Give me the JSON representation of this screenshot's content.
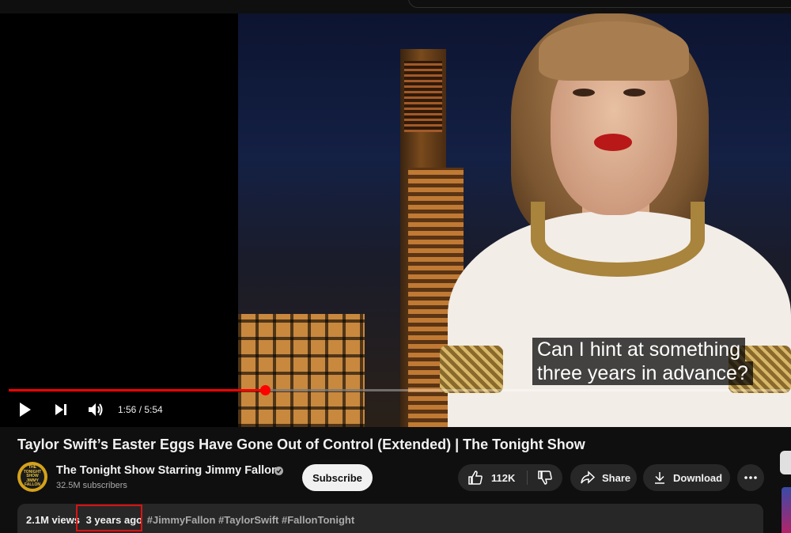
{
  "player": {
    "captions": [
      "Can I hint at something",
      "three years in advance?"
    ],
    "time_current": "1:56",
    "time_total": "5:54",
    "time_separator": " / ",
    "progress_fraction": 0.3276,
    "accent_color": "#ff0000"
  },
  "video": {
    "title": "Taylor Swift’s Easter Eggs Have Gone Out of Control (Extended) | The Tonight Show"
  },
  "channel": {
    "name": "The Tonight Show Starring Jimmy Fallon",
    "subscribers": "32.5M subscribers",
    "avatar_text": "THE TONIGHT SHOW JIMMY FALLON",
    "subscribe_label": "Subscribe"
  },
  "actions": {
    "like_count": "112K",
    "share_label": "Share",
    "download_label": "Download"
  },
  "description": {
    "views": "2.1M views",
    "uploaded": "3 years ago",
    "hashtags": "#JimmyFallon #TaylorSwift #FallonTonight"
  },
  "icons": {
    "play": "play-icon",
    "next": "next-icon",
    "volume": "volume-icon",
    "like": "thumbs-up-icon",
    "dislike": "thumbs-down-icon",
    "share": "share-arrow-icon",
    "download": "download-icon",
    "more": "more-horizontal-icon",
    "verified": "verified-check-icon"
  }
}
